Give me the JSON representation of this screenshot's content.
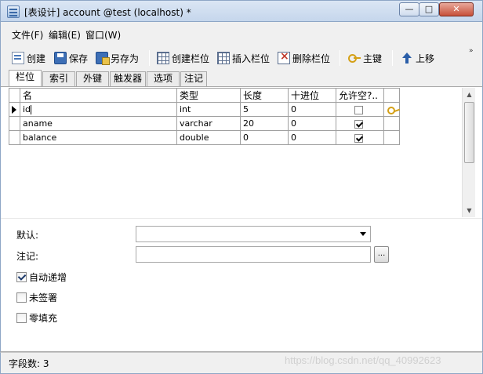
{
  "window": {
    "title": "[表设计] account @test (localhost) *",
    "min_glyph": "—",
    "max_glyph": "□",
    "close_glyph": "✕"
  },
  "menu": [
    "文件(F)",
    "编辑(E)",
    "窗口(W)"
  ],
  "toolbar": {
    "create": "创建",
    "save": "保存",
    "save_as": "另存为",
    "create_field": "创建栏位",
    "insert_field": "插入栏位",
    "delete_field": "删除栏位",
    "primary_key": "主键",
    "move_up": "上移",
    "more": "»"
  },
  "tabs": [
    "栏位",
    "索引",
    "外键",
    "触发器",
    "选项",
    "注记"
  ],
  "grid": {
    "columns": [
      "名",
      "类型",
      "长度",
      "十进位",
      "允许空?..",
      ""
    ],
    "rows": [
      {
        "name": "id",
        "type": "int",
        "length": "5",
        "decimal": "0",
        "nullable": false,
        "primary_key": true,
        "current": true
      },
      {
        "name": "aname",
        "type": "varchar",
        "length": "20",
        "decimal": "0",
        "nullable": true,
        "primary_key": false,
        "current": false
      },
      {
        "name": "balance",
        "type": "double",
        "length": "0",
        "decimal": "0",
        "nullable": true,
        "primary_key": false,
        "current": false
      }
    ]
  },
  "properties": {
    "default_label": "默认:",
    "default_value": "",
    "comment_label": "注记:",
    "comment_value": "",
    "ellipsis": "...",
    "auto_increment": {
      "label": "自动递增",
      "checked": true
    },
    "unsigned": {
      "label": "未签署",
      "checked": false
    },
    "zerofill": {
      "label": "零填充",
      "checked": false
    }
  },
  "status": {
    "field_count": "字段数: 3",
    "watermark": "https://blog.csdn.net/qq_40992623"
  }
}
